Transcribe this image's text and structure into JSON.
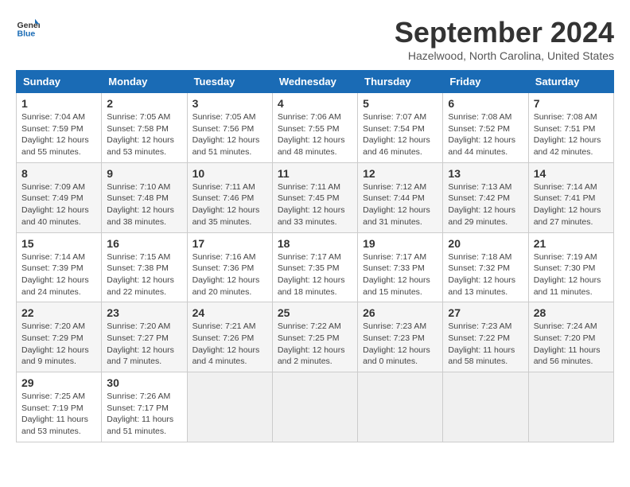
{
  "logo": {
    "line1": "General",
    "line2": "Blue"
  },
  "title": "September 2024",
  "location": "Hazelwood, North Carolina, United States",
  "days_of_week": [
    "Sunday",
    "Monday",
    "Tuesday",
    "Wednesday",
    "Thursday",
    "Friday",
    "Saturday"
  ],
  "weeks": [
    [
      {
        "day": 1,
        "sunrise": "7:04 AM",
        "sunset": "7:59 PM",
        "daylight": "12 hours and 55 minutes."
      },
      {
        "day": 2,
        "sunrise": "7:05 AM",
        "sunset": "7:58 PM",
        "daylight": "12 hours and 53 minutes."
      },
      {
        "day": 3,
        "sunrise": "7:05 AM",
        "sunset": "7:56 PM",
        "daylight": "12 hours and 51 minutes."
      },
      {
        "day": 4,
        "sunrise": "7:06 AM",
        "sunset": "7:55 PM",
        "daylight": "12 hours and 48 minutes."
      },
      {
        "day": 5,
        "sunrise": "7:07 AM",
        "sunset": "7:54 PM",
        "daylight": "12 hours and 46 minutes."
      },
      {
        "day": 6,
        "sunrise": "7:08 AM",
        "sunset": "7:52 PM",
        "daylight": "12 hours and 44 minutes."
      },
      {
        "day": 7,
        "sunrise": "7:08 AM",
        "sunset": "7:51 PM",
        "daylight": "12 hours and 42 minutes."
      }
    ],
    [
      {
        "day": 8,
        "sunrise": "7:09 AM",
        "sunset": "7:49 PM",
        "daylight": "12 hours and 40 minutes."
      },
      {
        "day": 9,
        "sunrise": "7:10 AM",
        "sunset": "7:48 PM",
        "daylight": "12 hours and 38 minutes."
      },
      {
        "day": 10,
        "sunrise": "7:11 AM",
        "sunset": "7:46 PM",
        "daylight": "12 hours and 35 minutes."
      },
      {
        "day": 11,
        "sunrise": "7:11 AM",
        "sunset": "7:45 PM",
        "daylight": "12 hours and 33 minutes."
      },
      {
        "day": 12,
        "sunrise": "7:12 AM",
        "sunset": "7:44 PM",
        "daylight": "12 hours and 31 minutes."
      },
      {
        "day": 13,
        "sunrise": "7:13 AM",
        "sunset": "7:42 PM",
        "daylight": "12 hours and 29 minutes."
      },
      {
        "day": 14,
        "sunrise": "7:14 AM",
        "sunset": "7:41 PM",
        "daylight": "12 hours and 27 minutes."
      }
    ],
    [
      {
        "day": 15,
        "sunrise": "7:14 AM",
        "sunset": "7:39 PM",
        "daylight": "12 hours and 24 minutes."
      },
      {
        "day": 16,
        "sunrise": "7:15 AM",
        "sunset": "7:38 PM",
        "daylight": "12 hours and 22 minutes."
      },
      {
        "day": 17,
        "sunrise": "7:16 AM",
        "sunset": "7:36 PM",
        "daylight": "12 hours and 20 minutes."
      },
      {
        "day": 18,
        "sunrise": "7:17 AM",
        "sunset": "7:35 PM",
        "daylight": "12 hours and 18 minutes."
      },
      {
        "day": 19,
        "sunrise": "7:17 AM",
        "sunset": "7:33 PM",
        "daylight": "12 hours and 15 minutes."
      },
      {
        "day": 20,
        "sunrise": "7:18 AM",
        "sunset": "7:32 PM",
        "daylight": "12 hours and 13 minutes."
      },
      {
        "day": 21,
        "sunrise": "7:19 AM",
        "sunset": "7:30 PM",
        "daylight": "12 hours and 11 minutes."
      }
    ],
    [
      {
        "day": 22,
        "sunrise": "7:20 AM",
        "sunset": "7:29 PM",
        "daylight": "12 hours and 9 minutes."
      },
      {
        "day": 23,
        "sunrise": "7:20 AM",
        "sunset": "7:27 PM",
        "daylight": "12 hours and 7 minutes."
      },
      {
        "day": 24,
        "sunrise": "7:21 AM",
        "sunset": "7:26 PM",
        "daylight": "12 hours and 4 minutes."
      },
      {
        "day": 25,
        "sunrise": "7:22 AM",
        "sunset": "7:25 PM",
        "daylight": "12 hours and 2 minutes."
      },
      {
        "day": 26,
        "sunrise": "7:23 AM",
        "sunset": "7:23 PM",
        "daylight": "12 hours and 0 minutes."
      },
      {
        "day": 27,
        "sunrise": "7:23 AM",
        "sunset": "7:22 PM",
        "daylight": "11 hours and 58 minutes."
      },
      {
        "day": 28,
        "sunrise": "7:24 AM",
        "sunset": "7:20 PM",
        "daylight": "11 hours and 56 minutes."
      }
    ],
    [
      {
        "day": 29,
        "sunrise": "7:25 AM",
        "sunset": "7:19 PM",
        "daylight": "11 hours and 53 minutes."
      },
      {
        "day": 30,
        "sunrise": "7:26 AM",
        "sunset": "7:17 PM",
        "daylight": "11 hours and 51 minutes."
      },
      null,
      null,
      null,
      null,
      null
    ]
  ]
}
